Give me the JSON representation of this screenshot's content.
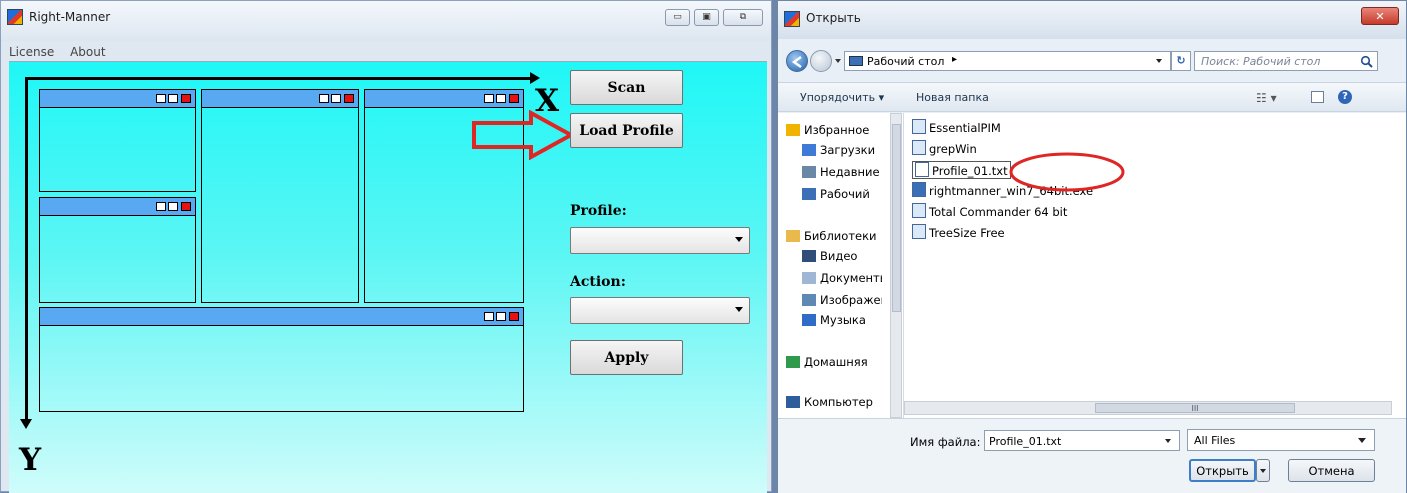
{
  "app": {
    "title": "Right-Manner",
    "window_controls": [
      "▭",
      "▣",
      "⧉"
    ],
    "menu": [
      "License",
      "About"
    ],
    "axis_x": "X",
    "axis_y": "Y",
    "buttons": {
      "scan": "Scan",
      "load_profile": "Load Profile",
      "apply": "Apply"
    },
    "profile_label": "Profile:",
    "action_label": "Action:",
    "profile_value": "",
    "action_value": ""
  },
  "dialog": {
    "title": "Открыть",
    "close_label": "✕",
    "address": "Рабочий стол",
    "address_sep": "▸",
    "search_placeholder": "Поиск: Рабочий стол",
    "toolbar": {
      "organize": "Упорядочить ▾",
      "new_folder": "Новая папка"
    },
    "nav_tree": [
      {
        "label": "Избранное",
        "icon": "star-icon",
        "color": "#f0b400"
      },
      {
        "label": "Загрузки",
        "icon": "downloads-icon",
        "color": "#3e7ad6"
      },
      {
        "label": "Недавние",
        "icon": "recent-places-icon",
        "color": "#6b87a8"
      },
      {
        "label": "Рабочий",
        "icon": "desktop-icon",
        "color": "#3c6fb6"
      },
      {
        "label": "Библиотеки",
        "icon": "library-icon",
        "color": "#e9b94c"
      },
      {
        "label": "Видео",
        "icon": "video-icon",
        "color": "#2f4f7a"
      },
      {
        "label": "Документы",
        "icon": "documents-icon",
        "color": "#9fb6d4"
      },
      {
        "label": "Изображения",
        "icon": "pictures-icon",
        "color": "#5f88b5"
      },
      {
        "label": "Музыка",
        "icon": "music-icon",
        "color": "#2e6cc7"
      },
      {
        "label": "Домашняя",
        "icon": "homegroup-icon",
        "color": "#2f9a4b"
      },
      {
        "label": "Компьютер",
        "icon": "computer-icon",
        "color": "#2d5d9b"
      }
    ],
    "files": [
      {
        "name": "EssentialPIM",
        "icon": "shortcut-icon"
      },
      {
        "name": "grepWin",
        "icon": "shortcut-icon"
      },
      {
        "name": "Profile_01.txt",
        "icon": "text-file-icon"
      },
      {
        "name": "rightmanner_win7_64bit.exe",
        "icon": "exe-icon"
      },
      {
        "name": "Total Commander 64 bit",
        "icon": "shortcut-icon"
      },
      {
        "name": "TreeSize Free",
        "icon": "shortcut-icon"
      }
    ],
    "filename_label": "Имя файла:",
    "filename_value": "Profile_01.txt",
    "filter_value": "All Files",
    "open_label": "Открыть",
    "cancel_label": "Отмена",
    "scroll_thumb": "III"
  },
  "colors": {
    "client_top": "#1ff7f6",
    "pane_bar": "#59a9f2",
    "annotation_red": "#e02525"
  }
}
